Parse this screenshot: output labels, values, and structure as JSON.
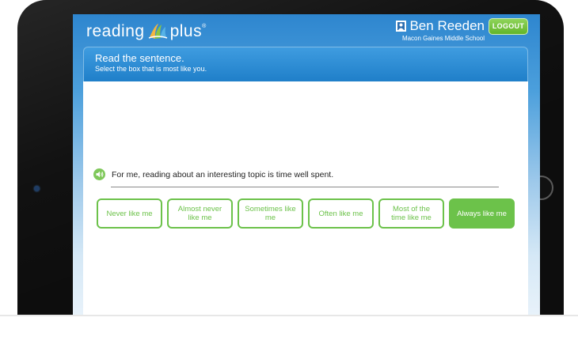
{
  "brand": {
    "word1": "reading",
    "word2": "plus",
    "reg": "®"
  },
  "user": {
    "name": "Ben Reeden",
    "school": "Macon Gaines Middle School"
  },
  "logout_label": "LOGOUT",
  "instruction": {
    "title": "Read the sentence.",
    "subtitle": "Select the box that is most like you."
  },
  "question": {
    "sentence": "For me, reading about an interesting topic is time well spent."
  },
  "options": [
    {
      "label": "Never like me",
      "selected": false
    },
    {
      "label": "Almost never like me",
      "selected": false
    },
    {
      "label": "Sometimes like me",
      "selected": false
    },
    {
      "label": "Often like me",
      "selected": false
    },
    {
      "label": "Most of the time like me",
      "selected": false
    },
    {
      "label": "Always like me",
      "selected": true
    }
  ],
  "colors": {
    "accent_green": "#6cc24a",
    "header_blue": "#2e86cf",
    "instruction_blue": "#1f7fc9"
  },
  "icons": {
    "logo": "reading-plus-logo-icon",
    "user": "user-icon",
    "audio": "speaker-icon"
  }
}
